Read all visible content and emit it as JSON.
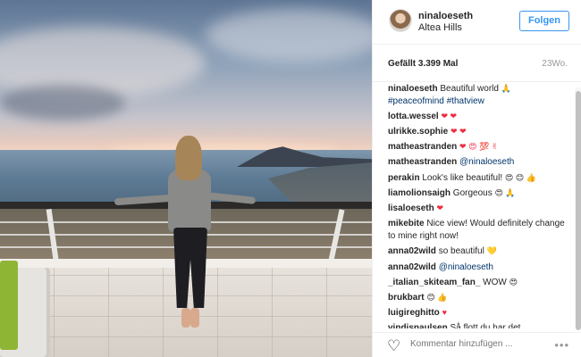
{
  "post": {
    "username": "ninaloeseth",
    "location": "Altea Hills",
    "follow_label": "Folgen",
    "likes": "Gefällt 3.399 Mal",
    "age": "23Wo."
  },
  "caption": {
    "user": "ninaloeseth",
    "text": "Beautiful world",
    "tags": "#peaceofmind #thatview"
  },
  "comments": [
    {
      "user": "lotta.wessel",
      "text": "",
      "emoji": "❤ ❤"
    },
    {
      "user": "ulrikke.sophie",
      "text": "",
      "emoji": "❤ ❤"
    },
    {
      "user": "matheastranden",
      "text": "",
      "emoji": "❤ 😍 💯 ✌"
    },
    {
      "user": "matheastranden",
      "text": "@ninaloeseth",
      "emoji": ""
    },
    {
      "user": "perakin",
      "text": "Look's like beautiful!",
      "emoji": "😍 😊 👍"
    },
    {
      "user": "liamolionsaigh",
      "text": "Gorgeous",
      "emoji": "😍 🙏"
    },
    {
      "user": "lisaloeseth",
      "text": "",
      "emoji": "❤"
    },
    {
      "user": "mikebite",
      "text": "Nice view! Would definitely change to mine right now!",
      "emoji": ""
    },
    {
      "user": "anna02wild",
      "text": "so beautiful",
      "emoji": "💛"
    },
    {
      "user": "anna02wild",
      "text": "@ninaloeseth",
      "emoji": ""
    },
    {
      "user": "_italian_skiteam_fan_",
      "text": "WOW",
      "emoji": "😍"
    },
    {
      "user": "brukbart",
      "text": "",
      "emoji": "😊 👍"
    },
    {
      "user": "luigireghitto",
      "text": "",
      "emoji": "♥"
    },
    {
      "user": "vindisnaulsen",
      "text": "Så flott du har det",
      "emoji": ""
    }
  ],
  "composer": {
    "placeholder": "Kommentar hinzufügen ...",
    "more_label": "•••"
  },
  "icons": {
    "like": "heart-outline-icon",
    "more": "ellipsis-icon"
  },
  "colors": {
    "accent": "#3897f0",
    "hashtag": "#003569",
    "heart": "#ed2d3e"
  }
}
